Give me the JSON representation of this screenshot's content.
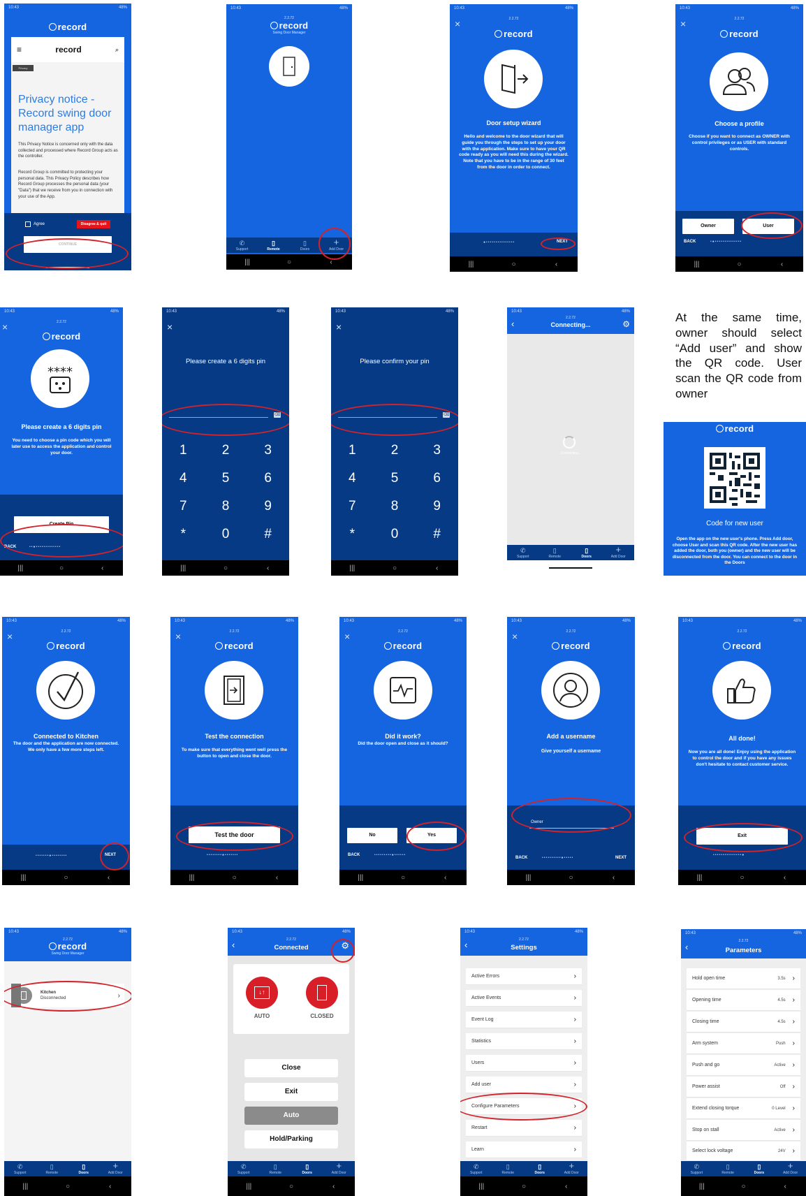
{
  "common": {
    "brand": "record",
    "version": "2.2.72",
    "subtitle": "Swing Door Manager",
    "time": "10:43",
    "signal": "48%",
    "close_glyph": "×",
    "chevron": "›",
    "back_arrow": "‹",
    "nav": [
      "|||",
      "○",
      "‹"
    ]
  },
  "tabs": {
    "support": "Support",
    "remote": "Remote",
    "doors": "Doors",
    "add_door": "Add Door"
  },
  "s1": {
    "menu_glyph": "≡",
    "search_glyph": "⌕",
    "tag": "Privacy",
    "heading": "Privacy notice - Record swing door manager app",
    "para1": "This Privacy Notice is concerned only with the data collected and processed where Record Group acts as the controller.",
    "para2": "Record Group is committed to protecting your personal data. This Privacy Policy describes how Record Group processes the personal data (your \"Data\") that we receive from you in connection with your use of the App.",
    "agree": "Agree",
    "disagree": "Disagree & quit",
    "continue": "CONTINUE"
  },
  "s3": {
    "title": "Door setup wizard",
    "body": "Hello and welcome to the door wizard that will guide you through the steps to set up your door with the application. Make sure to have your QR code ready as you will need this during the wizard. Note that you have to be in the range of 30 feet from the door in order to connect.",
    "next": "NEXT"
  },
  "s4": {
    "title": "Choose a profile",
    "body": "Choose if you want to connect as OWNER with control privileges or as USER with standard controls.",
    "owner": "Owner",
    "user": "User",
    "back": "BACK"
  },
  "s5": {
    "title": "Please create a 6 digits pin",
    "body": "You need to choose a pin code which you will later use to access the application and control your door.",
    "button": "Create Pin",
    "back": "BACK",
    "stars": "****"
  },
  "s6": {
    "title": "Please create a 6 digits pin"
  },
  "s7": {
    "title": "Please confirm your pin"
  },
  "keypad": [
    "1",
    "2",
    "3",
    "4",
    "5",
    "6",
    "7",
    "8",
    "9",
    "*",
    "0",
    "#"
  ],
  "pin_clear": "⌫",
  "s8": {
    "title": "Connecting...",
    "status": "Connecting..."
  },
  "caption": "At the same time, owner should select “Add user” and show the QR code. User scan the QR code from owner",
  "qr": {
    "title": "Code for new user",
    "body": "Open the app on the new user's phone. Press Add door, choose User and scan this QR code. After the new user has added the door, both you (owner) and the new user will be disconnected from the door. You can connect to the door in the Doors"
  },
  "s9": {
    "title": "Connected to Kitchen",
    "body": "The door and the application are now connected. We only have a few more steps left.",
    "next": "NEXT"
  },
  "s10": {
    "title": "Test the connection",
    "body": "To make sure that everything went well press the button to open and close the door.",
    "button": "Test the door"
  },
  "s11": {
    "title": "Did it work?",
    "body": "Did the door open and close as it should?",
    "no": "No",
    "yes": "Yes",
    "back": "BACK"
  },
  "s12": {
    "title": "Add a username",
    "body": "Give yourself a username",
    "value": "Owner",
    "back": "BACK",
    "next": "NEXT"
  },
  "s13": {
    "title": "All done!",
    "body": "Now you are all done! Enjoy using the application to control the door and if you have any issues don't hesitate to contact customer service.",
    "button": "Exit"
  },
  "s14": {
    "door_name": "Kitchen",
    "door_status": "Disconnected"
  },
  "s15": {
    "title": "Connected",
    "mode_auto": "AUTO",
    "mode_closed": "CLOSED",
    "buttons": [
      "Close",
      "Exit",
      "Auto",
      "Hold/Parking"
    ]
  },
  "s16": {
    "title": "Settings",
    "items": [
      "Active Errors",
      "Active Events",
      "Event Log",
      "Statistics",
      "Users",
      "Add user",
      "Configure Parameters",
      "Restart",
      "Learn"
    ]
  },
  "s17": {
    "title": "Parameters",
    "items": [
      {
        "label": "Hold open time",
        "value": "3.5s"
      },
      {
        "label": "Opening time",
        "value": "4.5s"
      },
      {
        "label": "Closing time",
        "value": "4.5s"
      },
      {
        "label": "Arm system",
        "value": "Push"
      },
      {
        "label": "Push and go",
        "value": "Active"
      },
      {
        "label": "Power assist",
        "value": "Off"
      },
      {
        "label": "Extend closing torque",
        "value": "0 Level"
      },
      {
        "label": "Stop on stall",
        "value": "Active"
      },
      {
        "label": "Select lock voltage",
        "value": "24V"
      }
    ]
  },
  "colors": {
    "brand_blue": "#1565e0",
    "dark_blue": "#063a85",
    "highlight_red": "#d3222a"
  }
}
